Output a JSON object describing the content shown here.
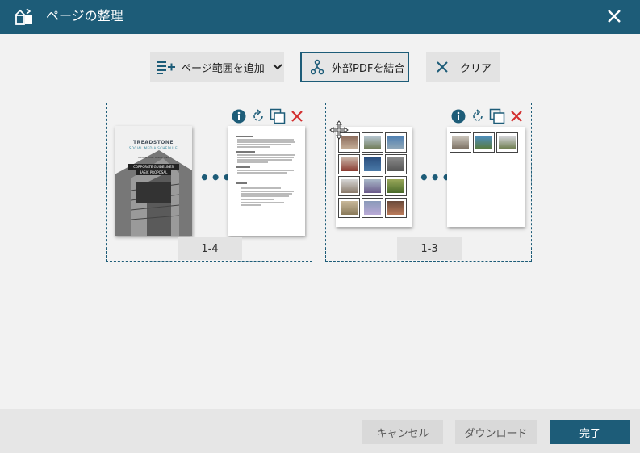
{
  "window": {
    "title": "ページの整理",
    "icon": "organize-pages-icon",
    "close_icon": "close-icon"
  },
  "toolbar": {
    "add_range_label": "ページ範囲を追加",
    "merge_label": "外部PDFを結合",
    "clear_label": "クリア"
  },
  "groups": [
    {
      "range_label": "1-4",
      "cover": {
        "title": "TREADSTONE",
        "subtitle": "SOCIAL MEDIA SCHEDULE",
        "tagline": "TREADSTONE MARKETING",
        "heading1": "CORPORATE GUIDELINES",
        "heading2": "BASIC PROPOSAL"
      }
    },
    {
      "range_label": "1-3"
    }
  ],
  "footer": {
    "cancel_label": "キャンセル",
    "download_label": "ダウンロード",
    "done_label": "完了"
  },
  "colors": {
    "accent": "#1d5c78",
    "delete": "#d32f2f",
    "background": "#f2f2f2"
  }
}
